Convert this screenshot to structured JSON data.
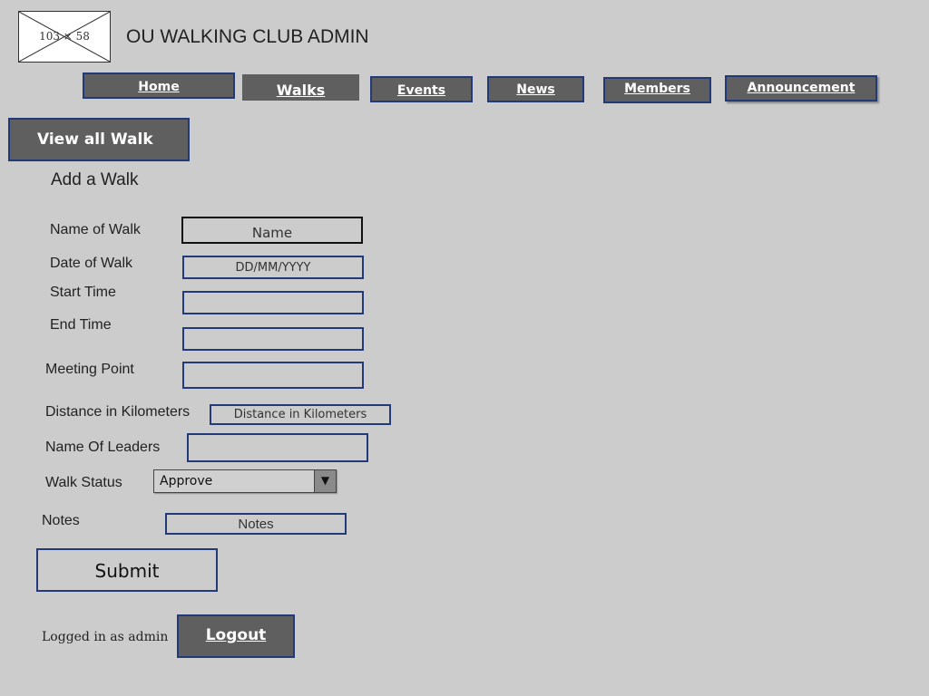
{
  "header": {
    "logo_placeholder": "103 × 58",
    "title": "OU WALKING CLUB ADMIN"
  },
  "nav": {
    "home": "Home",
    "walks": "Walks",
    "events": "Events",
    "news": "News",
    "members": "Members",
    "announcement": "Announcement",
    "active": "Walks"
  },
  "view_all_button": "View all Walk",
  "form": {
    "title": "Add a Walk",
    "fields": {
      "name": {
        "label": "Name of Walk",
        "value": "Name"
      },
      "date": {
        "label": "Date of Walk",
        "value": "DD/MM/YYYY"
      },
      "start_time": {
        "label": "Start Time",
        "value": ""
      },
      "end_time": {
        "label": "End Time",
        "value": ""
      },
      "meeting_point": {
        "label": "Meeting Point",
        "value": ""
      },
      "distance": {
        "label": "Distance in Kilometers",
        "value": "Distance in Kilometers"
      },
      "leaders": {
        "label": "Name Of Leaders",
        "value": ""
      },
      "status": {
        "label": "Walk Status",
        "value": "Approve"
      },
      "notes": {
        "label": "Notes",
        "value": "Notes"
      }
    },
    "submit": "Submit"
  },
  "footer": {
    "logged_in": "Logged in as admin",
    "logout": "Logout"
  },
  "colors": {
    "background": "#cccccc",
    "button_dark": "#5f5f5f",
    "border_blue": "#233a7a"
  }
}
